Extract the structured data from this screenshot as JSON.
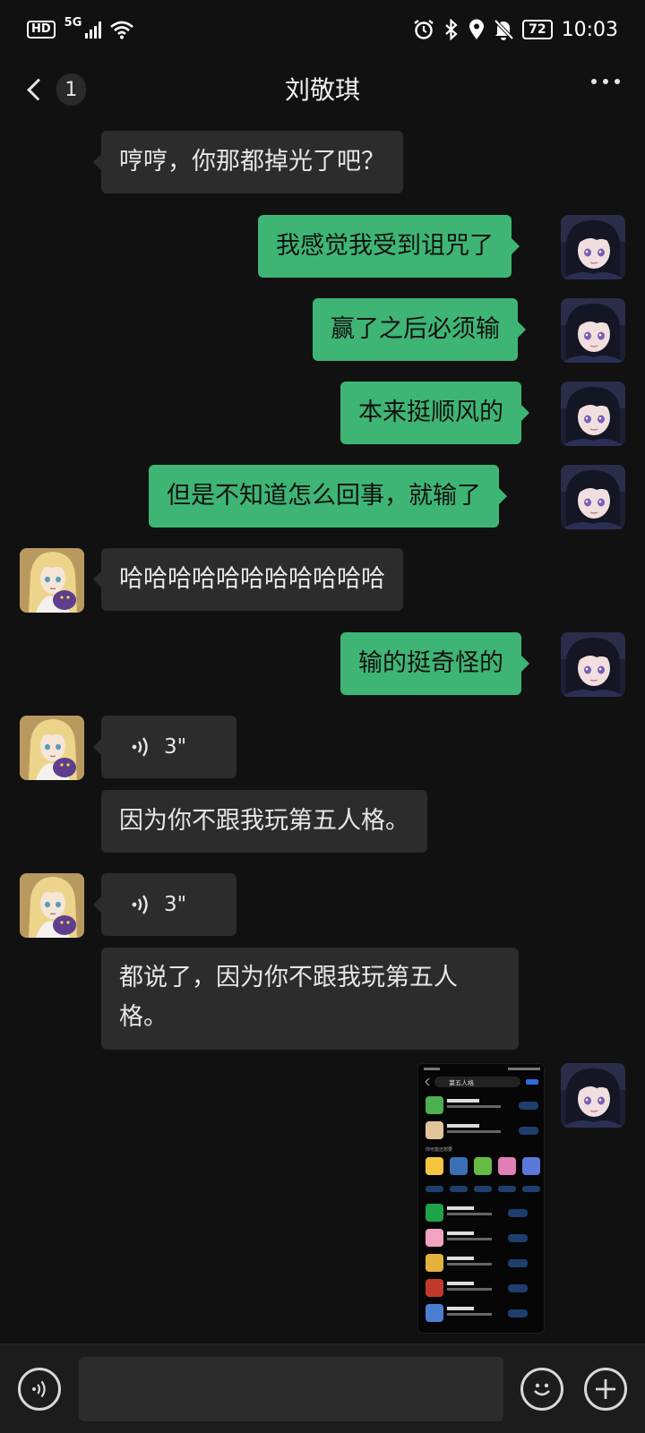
{
  "status_bar": {
    "hd": "HD",
    "network": "5G",
    "battery": "72",
    "time": "10:03"
  },
  "header": {
    "unread_count": "1",
    "title": "刘敬琪"
  },
  "messages": [
    {
      "side": "in",
      "text": "哼哼，你那都掉光了吧？"
    },
    {
      "side": "out",
      "text": "我感觉我受到诅咒了"
    },
    {
      "side": "out",
      "text": "赢了之后必须输"
    },
    {
      "side": "out",
      "text": "本来挺顺风的"
    },
    {
      "side": "out",
      "text": "但是不知道怎么回事，就输了"
    },
    {
      "side": "in",
      "text": "哈哈哈哈哈哈哈哈哈哈哈"
    },
    {
      "side": "out",
      "text": "输的挺奇怪的"
    },
    {
      "side": "in",
      "type": "voice",
      "duration": "3\""
    },
    {
      "side": "in",
      "text": "因为你不跟我玩第五人格。"
    },
    {
      "side": "in",
      "type": "voice",
      "duration": "3\""
    },
    {
      "side": "in",
      "text_line1": "都说了，因为你不跟我玩第五人",
      "text_line2": "格。"
    },
    {
      "side": "out",
      "type": "image"
    }
  ],
  "screenshot_preview": {
    "search_text": "第五人格",
    "apps": [
      "暗夜精灵",
      "我的世界",
      "迷你世界",
      "开心消消乐",
      "王者荣耀",
      "和平精英"
    ],
    "section_label": "你可能还想要"
  }
}
